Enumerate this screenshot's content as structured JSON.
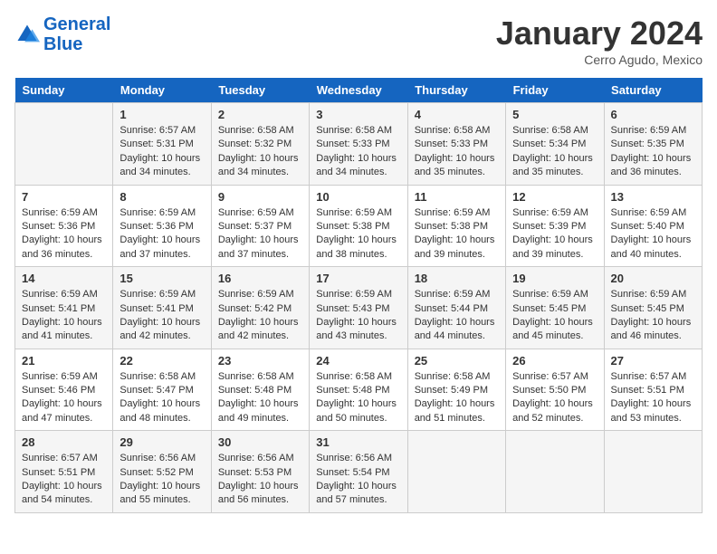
{
  "logo": {
    "text_general": "General",
    "text_blue": "Blue"
  },
  "title": "January 2024",
  "subtitle": "Cerro Agudo, Mexico",
  "days_header": [
    "Sunday",
    "Monday",
    "Tuesday",
    "Wednesday",
    "Thursday",
    "Friday",
    "Saturday"
  ],
  "weeks": [
    [
      {
        "day": "",
        "sunrise": "",
        "sunset": "",
        "daylight": ""
      },
      {
        "day": "1",
        "sunrise": "Sunrise: 6:57 AM",
        "sunset": "Sunset: 5:31 PM",
        "daylight": "Daylight: 10 hours and 34 minutes."
      },
      {
        "day": "2",
        "sunrise": "Sunrise: 6:58 AM",
        "sunset": "Sunset: 5:32 PM",
        "daylight": "Daylight: 10 hours and 34 minutes."
      },
      {
        "day": "3",
        "sunrise": "Sunrise: 6:58 AM",
        "sunset": "Sunset: 5:33 PM",
        "daylight": "Daylight: 10 hours and 34 minutes."
      },
      {
        "day": "4",
        "sunrise": "Sunrise: 6:58 AM",
        "sunset": "Sunset: 5:33 PM",
        "daylight": "Daylight: 10 hours and 35 minutes."
      },
      {
        "day": "5",
        "sunrise": "Sunrise: 6:58 AM",
        "sunset": "Sunset: 5:34 PM",
        "daylight": "Daylight: 10 hours and 35 minutes."
      },
      {
        "day": "6",
        "sunrise": "Sunrise: 6:59 AM",
        "sunset": "Sunset: 5:35 PM",
        "daylight": "Daylight: 10 hours and 36 minutes."
      }
    ],
    [
      {
        "day": "7",
        "sunrise": "Sunrise: 6:59 AM",
        "sunset": "Sunset: 5:36 PM",
        "daylight": "Daylight: 10 hours and 36 minutes."
      },
      {
        "day": "8",
        "sunrise": "Sunrise: 6:59 AM",
        "sunset": "Sunset: 5:36 PM",
        "daylight": "Daylight: 10 hours and 37 minutes."
      },
      {
        "day": "9",
        "sunrise": "Sunrise: 6:59 AM",
        "sunset": "Sunset: 5:37 PM",
        "daylight": "Daylight: 10 hours and 37 minutes."
      },
      {
        "day": "10",
        "sunrise": "Sunrise: 6:59 AM",
        "sunset": "Sunset: 5:38 PM",
        "daylight": "Daylight: 10 hours and 38 minutes."
      },
      {
        "day": "11",
        "sunrise": "Sunrise: 6:59 AM",
        "sunset": "Sunset: 5:38 PM",
        "daylight": "Daylight: 10 hours and 39 minutes."
      },
      {
        "day": "12",
        "sunrise": "Sunrise: 6:59 AM",
        "sunset": "Sunset: 5:39 PM",
        "daylight": "Daylight: 10 hours and 39 minutes."
      },
      {
        "day": "13",
        "sunrise": "Sunrise: 6:59 AM",
        "sunset": "Sunset: 5:40 PM",
        "daylight": "Daylight: 10 hours and 40 minutes."
      }
    ],
    [
      {
        "day": "14",
        "sunrise": "Sunrise: 6:59 AM",
        "sunset": "Sunset: 5:41 PM",
        "daylight": "Daylight: 10 hours and 41 minutes."
      },
      {
        "day": "15",
        "sunrise": "Sunrise: 6:59 AM",
        "sunset": "Sunset: 5:41 PM",
        "daylight": "Daylight: 10 hours and 42 minutes."
      },
      {
        "day": "16",
        "sunrise": "Sunrise: 6:59 AM",
        "sunset": "Sunset: 5:42 PM",
        "daylight": "Daylight: 10 hours and 42 minutes."
      },
      {
        "day": "17",
        "sunrise": "Sunrise: 6:59 AM",
        "sunset": "Sunset: 5:43 PM",
        "daylight": "Daylight: 10 hours and 43 minutes."
      },
      {
        "day": "18",
        "sunrise": "Sunrise: 6:59 AM",
        "sunset": "Sunset: 5:44 PM",
        "daylight": "Daylight: 10 hours and 44 minutes."
      },
      {
        "day": "19",
        "sunrise": "Sunrise: 6:59 AM",
        "sunset": "Sunset: 5:45 PM",
        "daylight": "Daylight: 10 hours and 45 minutes."
      },
      {
        "day": "20",
        "sunrise": "Sunrise: 6:59 AM",
        "sunset": "Sunset: 5:45 PM",
        "daylight": "Daylight: 10 hours and 46 minutes."
      }
    ],
    [
      {
        "day": "21",
        "sunrise": "Sunrise: 6:59 AM",
        "sunset": "Sunset: 5:46 PM",
        "daylight": "Daylight: 10 hours and 47 minutes."
      },
      {
        "day": "22",
        "sunrise": "Sunrise: 6:58 AM",
        "sunset": "Sunset: 5:47 PM",
        "daylight": "Daylight: 10 hours and 48 minutes."
      },
      {
        "day": "23",
        "sunrise": "Sunrise: 6:58 AM",
        "sunset": "Sunset: 5:48 PM",
        "daylight": "Daylight: 10 hours and 49 minutes."
      },
      {
        "day": "24",
        "sunrise": "Sunrise: 6:58 AM",
        "sunset": "Sunset: 5:48 PM",
        "daylight": "Daylight: 10 hours and 50 minutes."
      },
      {
        "day": "25",
        "sunrise": "Sunrise: 6:58 AM",
        "sunset": "Sunset: 5:49 PM",
        "daylight": "Daylight: 10 hours and 51 minutes."
      },
      {
        "day": "26",
        "sunrise": "Sunrise: 6:57 AM",
        "sunset": "Sunset: 5:50 PM",
        "daylight": "Daylight: 10 hours and 52 minutes."
      },
      {
        "day": "27",
        "sunrise": "Sunrise: 6:57 AM",
        "sunset": "Sunset: 5:51 PM",
        "daylight": "Daylight: 10 hours and 53 minutes."
      }
    ],
    [
      {
        "day": "28",
        "sunrise": "Sunrise: 6:57 AM",
        "sunset": "Sunset: 5:51 PM",
        "daylight": "Daylight: 10 hours and 54 minutes."
      },
      {
        "day": "29",
        "sunrise": "Sunrise: 6:56 AM",
        "sunset": "Sunset: 5:52 PM",
        "daylight": "Daylight: 10 hours and 55 minutes."
      },
      {
        "day": "30",
        "sunrise": "Sunrise: 6:56 AM",
        "sunset": "Sunset: 5:53 PM",
        "daylight": "Daylight: 10 hours and 56 minutes."
      },
      {
        "day": "31",
        "sunrise": "Sunrise: 6:56 AM",
        "sunset": "Sunset: 5:54 PM",
        "daylight": "Daylight: 10 hours and 57 minutes."
      },
      {
        "day": "",
        "sunrise": "",
        "sunset": "",
        "daylight": ""
      },
      {
        "day": "",
        "sunrise": "",
        "sunset": "",
        "daylight": ""
      },
      {
        "day": "",
        "sunrise": "",
        "sunset": "",
        "daylight": ""
      }
    ]
  ]
}
